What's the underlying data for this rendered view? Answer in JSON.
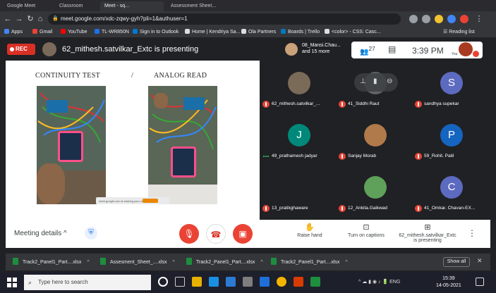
{
  "browser": {
    "tabs": [
      {
        "label": "Google Meet"
      },
      {
        "label": "Classroom"
      },
      {
        "label": "Meet - sq..."
      },
      {
        "label": "Assessment Sheet..."
      }
    ],
    "url": "meet.google.com/xdc-zqwy-gyh?pli=1&authuser=1",
    "bookmarks": [
      {
        "label": "Apps",
        "color": "#4285f4"
      },
      {
        "label": "Gmail",
        "color": "#ea4335"
      },
      {
        "label": "YouTube",
        "color": "#ff0000"
      },
      {
        "label": "TL-WR850N",
        "color": "#1a73e8"
      },
      {
        "label": "Sign in to Outlook",
        "color": "#0078d4"
      },
      {
        "label": "Home | Kendriya Sa...",
        "color": "#dddddd"
      },
      {
        "label": "Ola Partners",
        "color": "#dddddd"
      },
      {
        "label": "Boards | Trello",
        "color": "#0079bf"
      },
      {
        "label": "<color> - CSS: Casc...",
        "color": "#dddddd"
      }
    ],
    "reading_list": "Reading list"
  },
  "meet": {
    "rec_label": "REC",
    "presenting_title": "62_mithesh.satvilkar_Extc is presenting",
    "others_line1": "08_Mansi.Chau...",
    "others_line2": "and 15 more",
    "people_count": "27",
    "time": "3:39 PM",
    "you_label": "You"
  },
  "slide": {
    "title_left": "CONTINUITY TEST",
    "separator": "/",
    "title_right": "ANALOG READ",
    "sharebar_text": "meet.google.com is sharing your screen",
    "sharebar_stop": "Stop sharing"
  },
  "participants": [
    {
      "name": "62_mithesh.satvilkar_...",
      "initial": "",
      "color": "#7a6a58",
      "muted": true
    },
    {
      "name": "41_Siddhi Raut",
      "initial": "",
      "color": "#5f6368",
      "muted": true
    },
    {
      "name": "sandhya supekar",
      "initial": "S",
      "color": "#5c6bc0",
      "muted": true
    },
    {
      "name": "49_prathamesh jadyar",
      "initial": "J",
      "color": "#00897b",
      "muted": false
    },
    {
      "name": "Sanjay Morab",
      "initial": "",
      "color": "#b07a4a",
      "muted": true
    },
    {
      "name": "59_Rohit. Patil",
      "initial": "P",
      "color": "#1565c0",
      "muted": true
    },
    {
      "name": "13_pratikghaware",
      "initial": "",
      "color": "#202124",
      "muted": true
    },
    {
      "name": "12_Ankita.Gaikwad",
      "initial": "",
      "color": "#5fa05a",
      "muted": true
    },
    {
      "name": "41_Omkar. Chavan-EX...",
      "initial": "C",
      "color": "#5c6bc0",
      "muted": true
    }
  ],
  "controls": {
    "meeting_details": "Meeting details",
    "raise_hand": "Raise hand",
    "captions": "Turn on captions",
    "presenting_line1": "62_mithesh.satvilkar_Extc",
    "presenting_line2": "is presenting"
  },
  "downloads": {
    "items": [
      {
        "label": "Track2_Panel1_Part....xlsx"
      },
      {
        "label": "Assesment_Sheet_....xlsx"
      },
      {
        "label": "Track2_Panel1_Part....xlsx"
      },
      {
        "label": "Track2_Panel1_Part....xlsx"
      }
    ],
    "show_all": "Show all"
  },
  "taskbar": {
    "search_placeholder": "Type here to search",
    "lang": "ENG",
    "clock_time": "15:39",
    "clock_date": "14-05-2021"
  }
}
